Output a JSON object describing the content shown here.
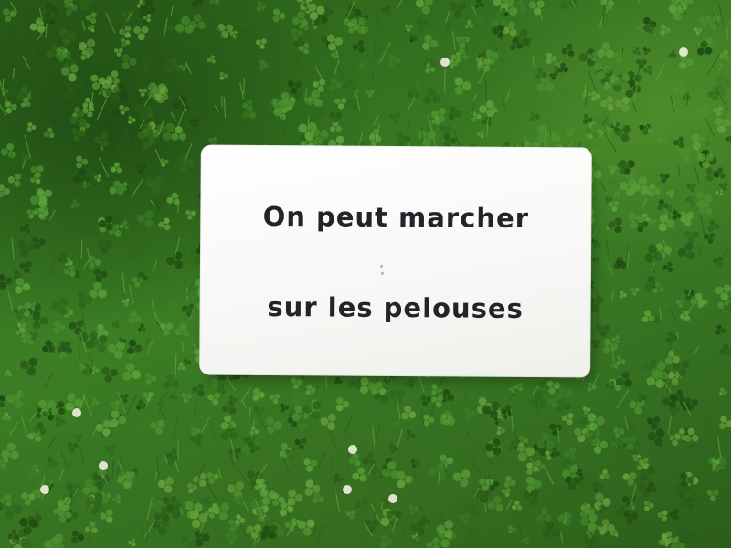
{
  "sign": {
    "line_1": "On peut marcher",
    "line_2": "sur les pelouses"
  },
  "colors": {
    "grass": "#3c7e24",
    "sign_background": "#ffffff",
    "sign_text": "#23232a",
    "clover_flower": "#f2efe2"
  }
}
